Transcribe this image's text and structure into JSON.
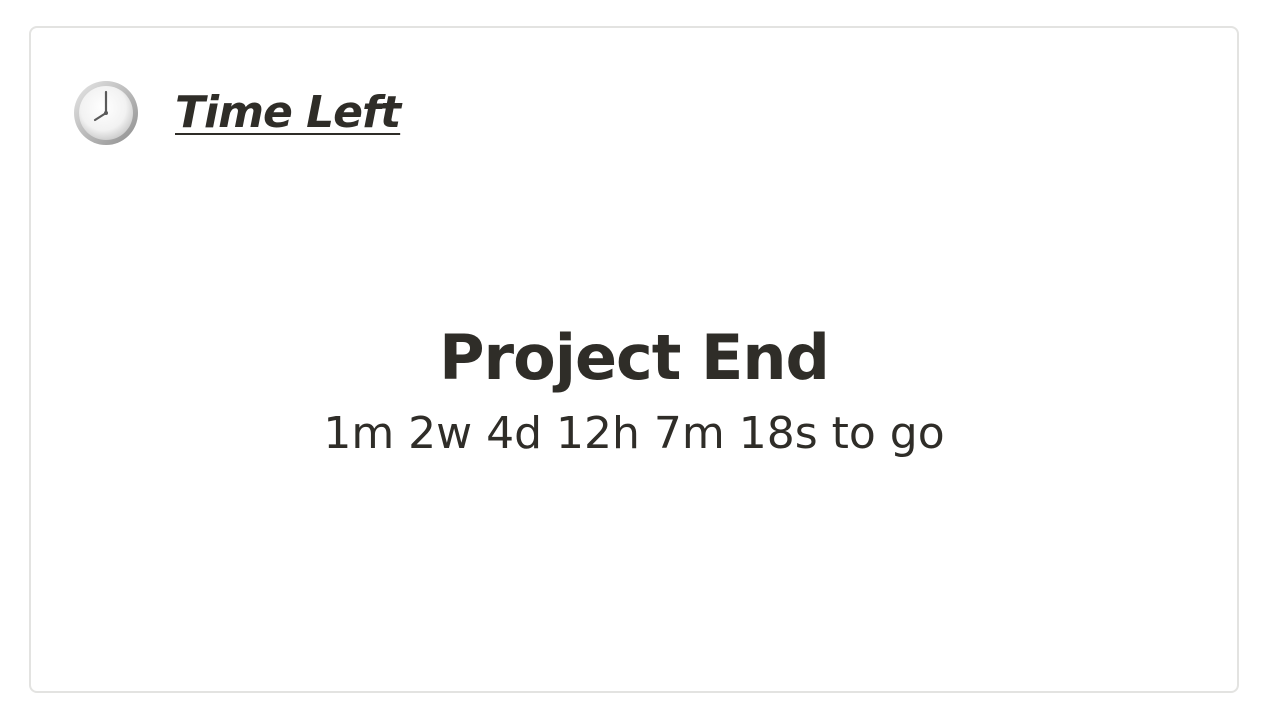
{
  "widget": {
    "icon": "clock-icon",
    "title": "Time Left",
    "event_name": "Project End",
    "countdown": "1m 2w 4d 12h 7m 18s to go"
  }
}
